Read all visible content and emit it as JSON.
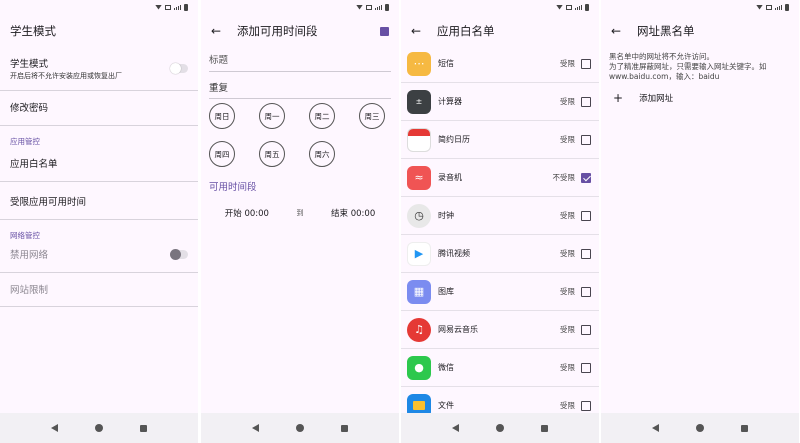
{
  "screens": {
    "s1": {
      "title": "学生模式",
      "student_mode": {
        "title": "学生模式",
        "subtitle": "开启后将不允许安装应用或恢复出厂"
      },
      "change_password": "修改密码",
      "section_app": "应用管控",
      "app_whitelist": "应用白名单",
      "limited_time": "受限应用可用时间",
      "section_net": "网络管控",
      "disable_network": "禁用网络",
      "website_limit": "网站限制"
    },
    "s2": {
      "title": "添加可用时间段",
      "title_placeholder": "标题",
      "repeat_label": "重复",
      "days": [
        "周日",
        "周一",
        "周二",
        "周三",
        "周四",
        "周五",
        "周六"
      ],
      "period_label": "可用时间段",
      "start": "开始 00:00",
      "to": "到",
      "end": "结束 00:00"
    },
    "s3": {
      "title": "应用白名单",
      "apps": [
        {
          "name": "短信",
          "state": "受限",
          "checked": false
        },
        {
          "name": "计算器",
          "state": "受限",
          "checked": false
        },
        {
          "name": "简约日历",
          "state": "受限",
          "checked": false
        },
        {
          "name": "录音机",
          "state": "不受限",
          "checked": true
        },
        {
          "name": "时钟",
          "state": "受限",
          "checked": false
        },
        {
          "name": "腾讯视频",
          "state": "受限",
          "checked": false
        },
        {
          "name": "图库",
          "state": "受限",
          "checked": false
        },
        {
          "name": "网易云音乐",
          "state": "受限",
          "checked": false
        },
        {
          "name": "微信",
          "state": "受限",
          "checked": false
        },
        {
          "name": "文件",
          "state": "受限",
          "checked": false
        }
      ]
    },
    "s4": {
      "title": "网址黑名单",
      "desc1": "黑名单中的网址将不允许访问。",
      "desc2": "为了精准屏蔽网址，只需要输入网址关键字。如",
      "desc3": "www.baidu.com，输入：baidu",
      "add_url": "添加网址"
    }
  },
  "colors": {
    "accent": "#6750a4",
    "background": "#fef7ff",
    "navbar": "#f2f0f4"
  }
}
